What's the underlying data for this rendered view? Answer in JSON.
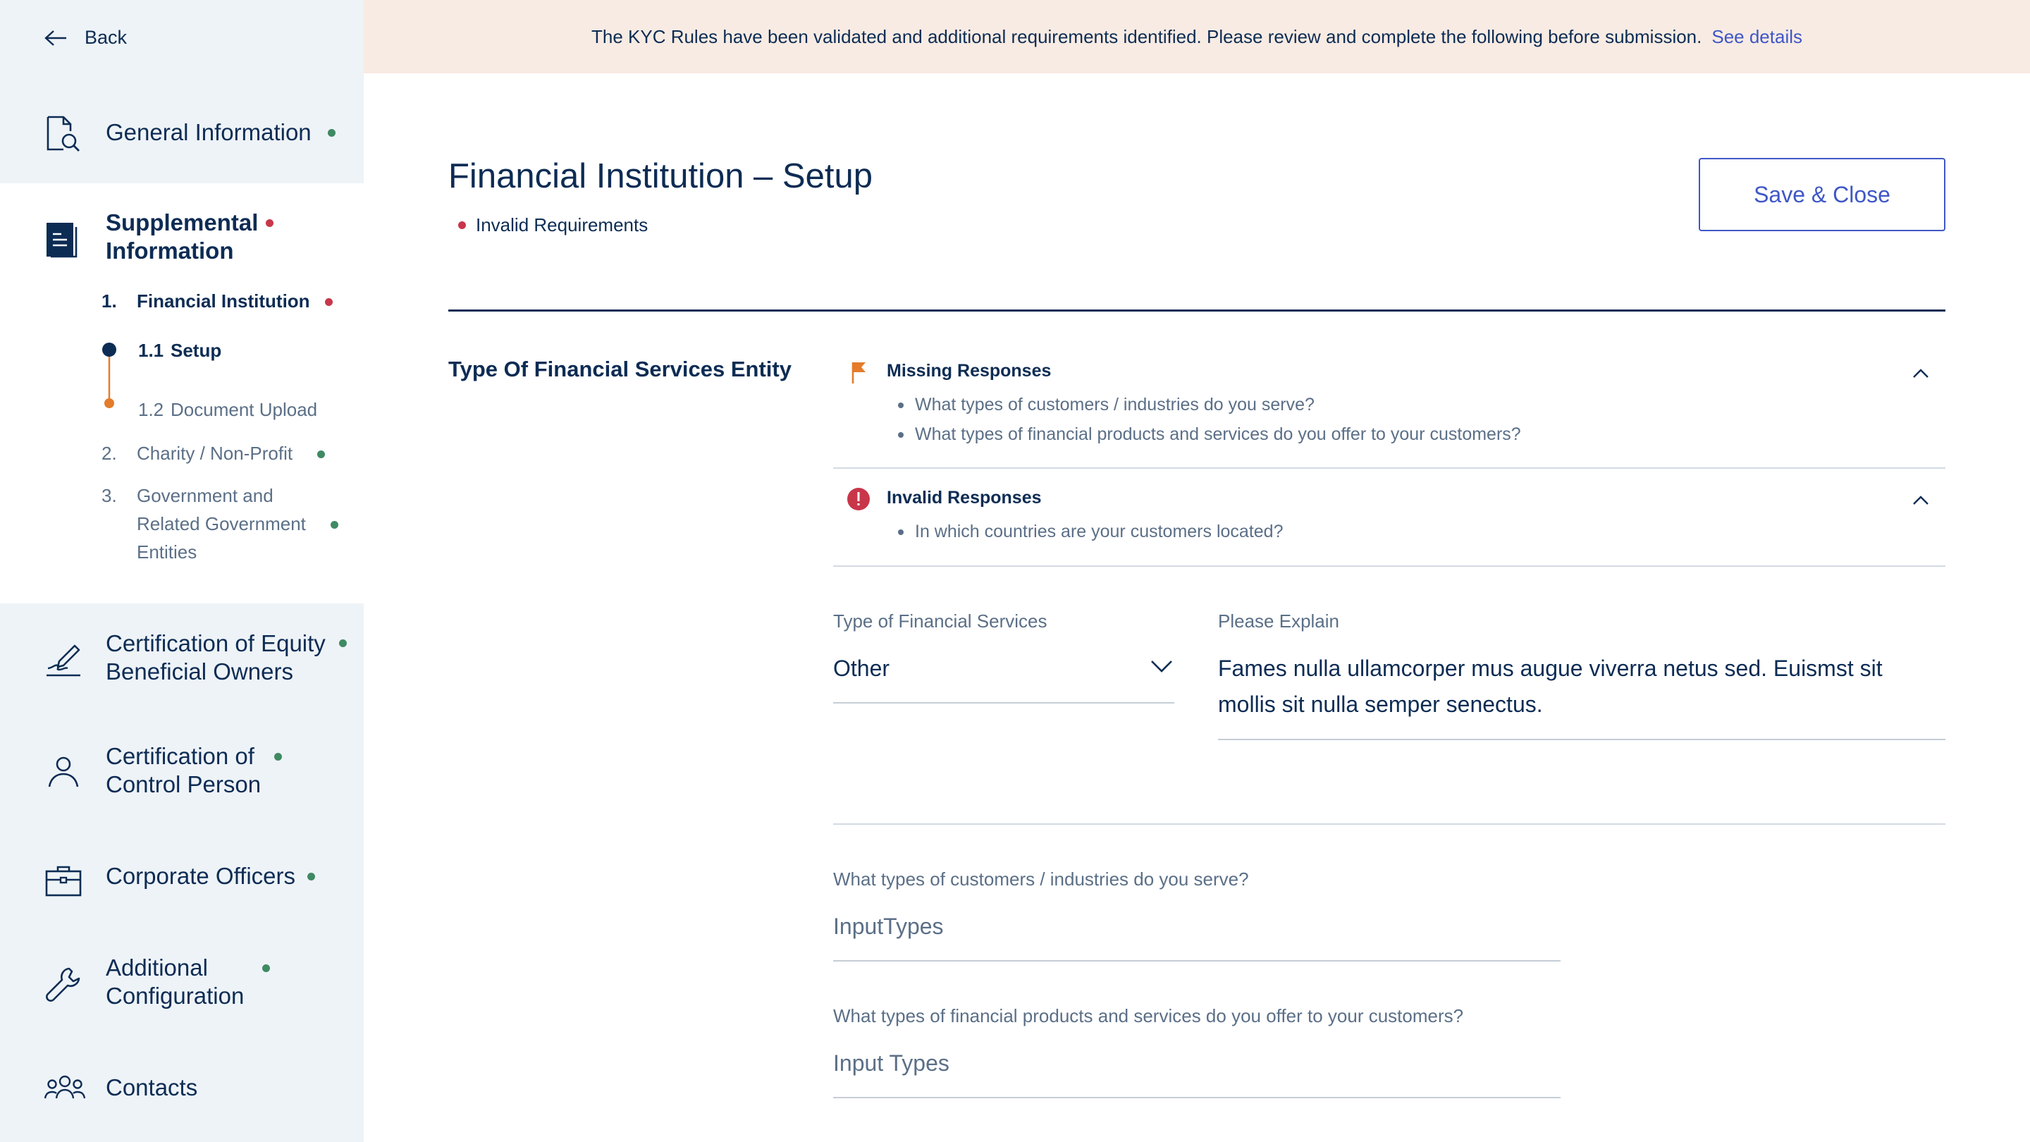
{
  "banner": {
    "message": "The KYC Rules have been validated and additional requirements identified. Please review and complete the following before submission.",
    "link": "See details"
  },
  "sidebar": {
    "back": "Back",
    "items": [
      {
        "label": "General Information",
        "status": "green"
      },
      {
        "label_line1": "Supplemental",
        "label_line2": "Information",
        "status": "red"
      },
      {
        "label_line1": "Certification of Equity",
        "label_line2": "Beneficial Owners",
        "status": "green"
      },
      {
        "label_line1": "Certification of",
        "label_line2": "Control Person",
        "status": "green"
      },
      {
        "label": "Corporate Officers",
        "status": "green"
      },
      {
        "label_line1": "Additional",
        "label_line2": "Configuration",
        "status": "green"
      },
      {
        "label": "Contacts"
      }
    ],
    "sub": {
      "fi_num": "1.",
      "fi_label": "Financial Institution",
      "setup_num": "1.1",
      "setup_label": "Setup",
      "doc_num": "1.2",
      "doc_label": "Document Upload",
      "charity_num": "2.",
      "charity_label": "Charity / Non-Profit",
      "gov_num": "3.",
      "gov_line1": "Government and",
      "gov_line2": "Related Government",
      "gov_line3": "Entities"
    }
  },
  "main": {
    "title": "Financial Institution – Setup",
    "status": "Invalid Requirements",
    "save_label": "Save & Close",
    "section_title": "Type Of Financial Services Entity",
    "missing": {
      "title": "Missing Responses",
      "items": [
        "What types of customers / industries do you serve?",
        "What types of financial products and services do you offer to your customers?"
      ]
    },
    "invalid": {
      "title": "Invalid Responses",
      "items": [
        "In which countries are your customers located?"
      ]
    },
    "fields": {
      "type_label": "Type of Financial Services",
      "type_value": "Other",
      "explain_label": "Please Explain",
      "explain_line1": "Fames nulla ullamcorper mus augue viverra netus sed. Euismst sit",
      "explain_line2": "mollis sit nulla semper senectus.",
      "customers_label": "What types of customers / industries do you serve?",
      "customers_placeholder": "InputTypes",
      "products_label": "What types of financial products and services do you offer to your customers?",
      "products_placeholder": "Input Types"
    }
  },
  "colors": {
    "navy": "#0d2c54",
    "accent": "#3f57c6",
    "status_green": "#3f8a63",
    "status_red": "#c8364a",
    "step_orange": "#e47c2a",
    "banner_bg": "#f8ebe3",
    "sidebar_bg": "#eef3f7"
  }
}
